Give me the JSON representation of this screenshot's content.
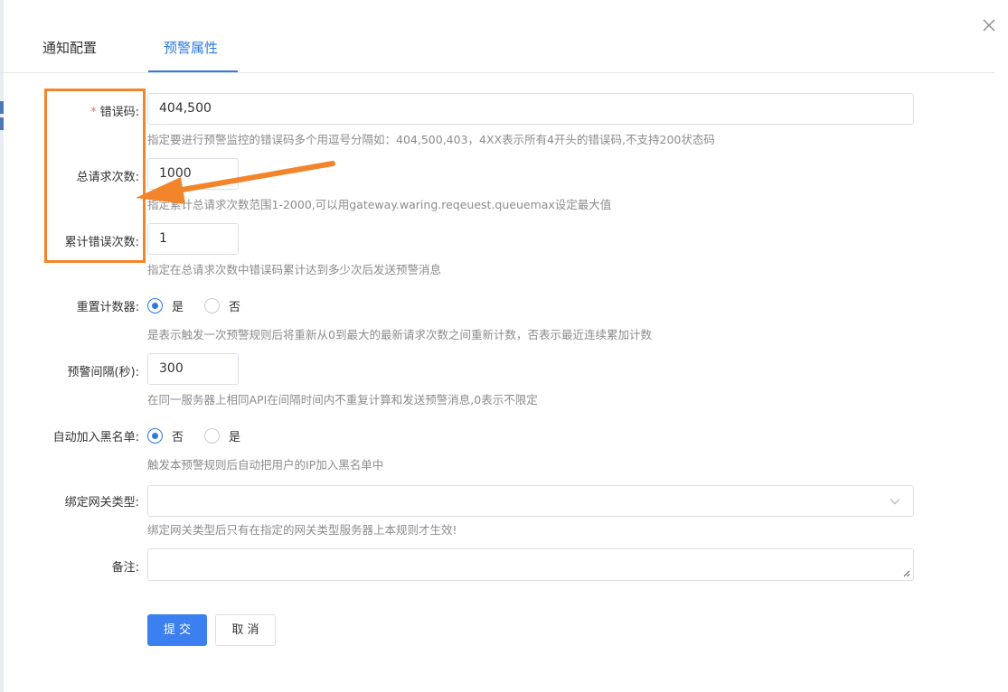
{
  "tabs": [
    {
      "label": "通知配置",
      "active": false
    },
    {
      "label": "预警属性",
      "active": true
    }
  ],
  "form": {
    "error_code": {
      "required_mark": "*",
      "label": "错误码:",
      "value": "404,500",
      "hint": "指定要进行预警监控的错误码多个用逗号分隔如：404,500,403，4XX表示所有4开头的错误码,不支持200状态码"
    },
    "total_requests": {
      "label": "总请求次数:",
      "value": "1000",
      "hint": "指定累计总请求次数范围1-2000,可以用gateway.waring.reqeuest.queuemax设定最大值"
    },
    "error_count": {
      "label": "累计错误次数:",
      "value": "1",
      "hint": "指定在总请求次数中错误码累计达到多少次后发送预警消息"
    },
    "reset_counter": {
      "label": "重置计数器:",
      "options": [
        "是",
        "否"
      ],
      "selected": "是",
      "hint": "是表示触发一次预警规则后将重新从0到最大的最新请求次数之间重新计数，否表示最近连续累加计数"
    },
    "alert_interval": {
      "label": "预警间隔(秒):",
      "value": "300",
      "hint": "在同一服务器上相同API在间隔时间内不重复计算和发送预警消息,0表示不限定"
    },
    "auto_blacklist": {
      "label": "自动加入黑名单:",
      "options": [
        "否",
        "是"
      ],
      "selected": "否",
      "hint": "触发本预警规则后自动把用户的IP加入黑名单中"
    },
    "gateway_type": {
      "label": "绑定网关类型:",
      "value": "",
      "hint": "绑定网关类型后只有在指定的网关类型服务器上本规则才生效!"
    },
    "remark": {
      "label": "备注:",
      "value": ""
    }
  },
  "buttons": {
    "submit": "提 交",
    "cancel": "取 消"
  },
  "colors": {
    "accent": "#2f79e0",
    "primary_button": "#3b7ff0",
    "annotation": "#f2852b",
    "required": "#f56c6c"
  },
  "icons": {
    "close": "close-icon",
    "select": "chevron-down-icon",
    "textarea": "resize-grip-icon"
  }
}
